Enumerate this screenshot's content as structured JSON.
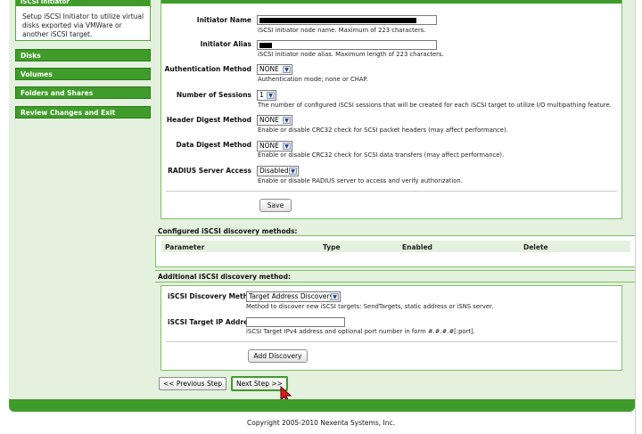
{
  "sidebar": {
    "header": "iSCSI Initiator",
    "description": "Setup iSCSI Initiator to utilize virtual disks exported via VMWare or another iSCSI target.",
    "items": [
      {
        "label": "Disks"
      },
      {
        "label": "Volumes"
      },
      {
        "label": "Folders and Shares"
      },
      {
        "label": "Review Changes and Exit"
      }
    ]
  },
  "params": {
    "initiator_name": {
      "label": "Initiator Name",
      "hint": "iSCSI initiator node name. Maximum of 223 characters."
    },
    "initiator_alias": {
      "label": "Initiator Alias",
      "hint": "iSCSI initiator node alias. Maximum length of 223 characters."
    },
    "auth_method": {
      "label": "Authentication Method",
      "value": "NONE",
      "hint": "Authentication mode; none or CHAP."
    },
    "sessions": {
      "label": "Number of Sessions",
      "value": "1",
      "hint": "The number of configured iSCSI sessions that will be created for each iSCSI target to utilize I/O multipathing feature."
    },
    "header_digest": {
      "label": "Header Digest Method",
      "value": "NONE",
      "hint": "Enable or disable CRC32 check for SCSI packet headers (may affect performance)."
    },
    "data_digest": {
      "label": "Data Digest Method",
      "value": "NONE",
      "hint": "Enable or disable CRC32 check for SCSI data transfers (may affect performance)."
    },
    "radius": {
      "label": "RADIUS Server Access",
      "value": "Disabled",
      "hint": "Enable or disable RADIUS server to access and verify authorization."
    },
    "save_label": "Save"
  },
  "configured": {
    "title": "Configured iSCSI discovery methods:",
    "columns": [
      "Parameter",
      "Type",
      "Enabled",
      "Delete"
    ]
  },
  "additional": {
    "title": "Additional iSCSI discovery method:",
    "method": {
      "label": "iSCSI Discovery Method",
      "value": "Target Address Discovery",
      "hint": "Method to discover new iSCSI targets: SendTargets, static address or iSNS server."
    },
    "target_ip": {
      "label": "iSCSI Target IP Address",
      "value": "",
      "hint": "iSCSI Target IPv4 address and optional port number in form #.#.#.#[:port]."
    },
    "add_label": "Add Discovery"
  },
  "navigation": {
    "prev_label": "<< Previous Step",
    "next_label": "Next Step >>"
  },
  "footer": {
    "copyright": "Copyright 2005-2010 Nexenta Systems, Inc."
  },
  "colors": {
    "accent_green": "#3f9c2a",
    "panel_bg": "#e4f1de"
  }
}
